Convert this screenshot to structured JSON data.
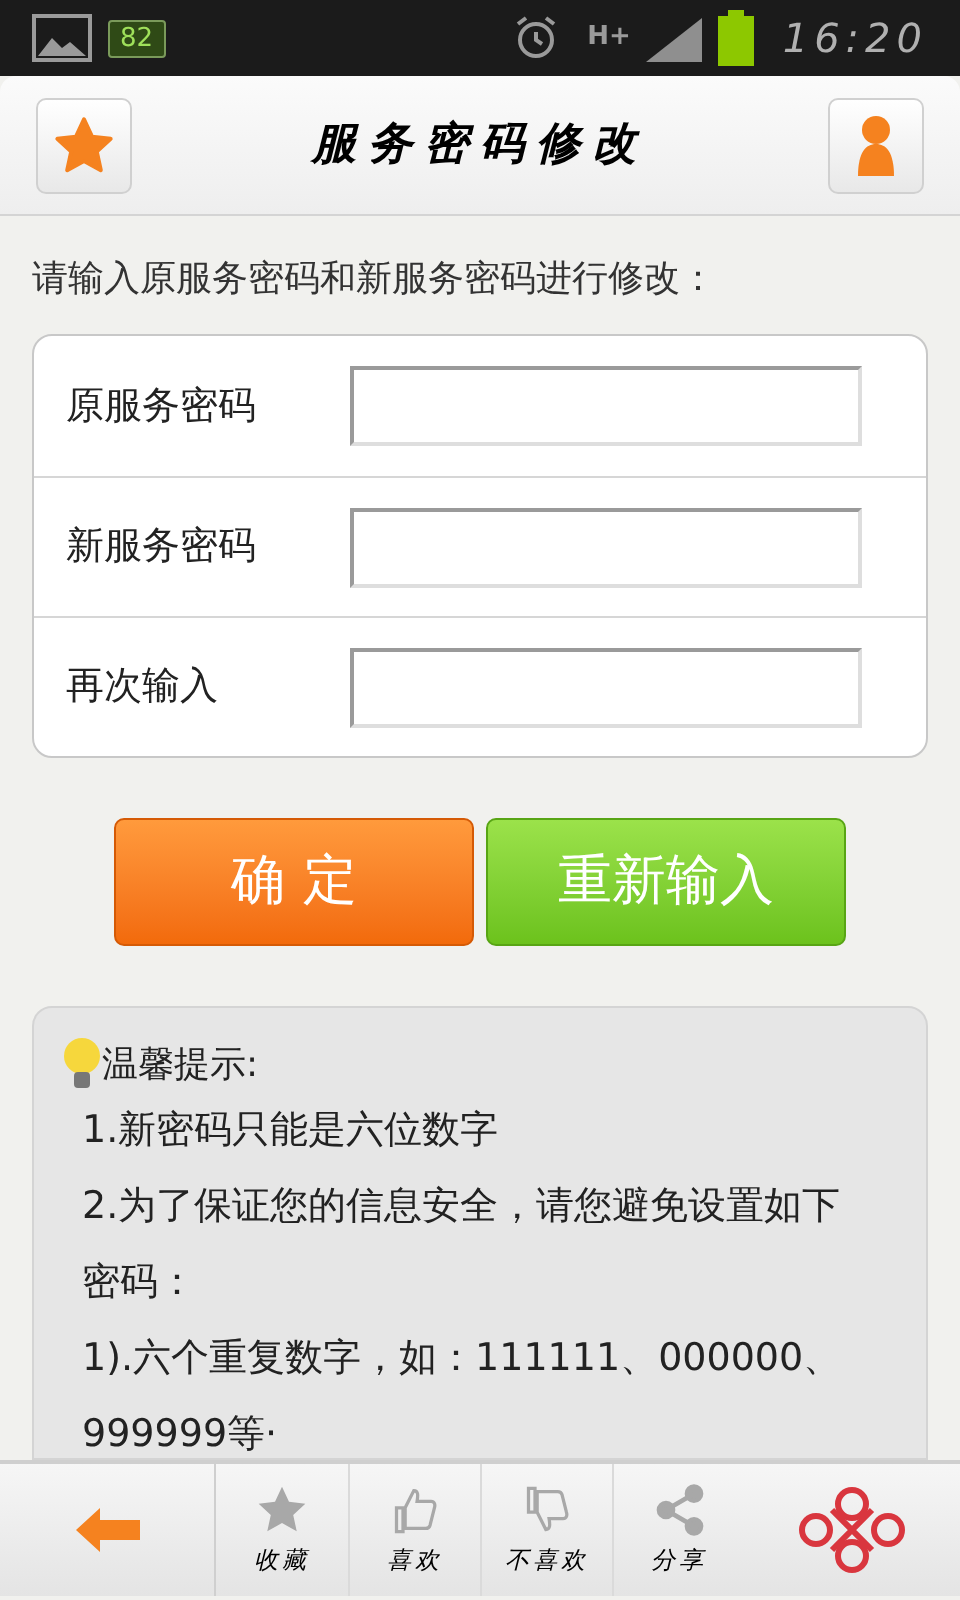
{
  "status_bar": {
    "battery_badge": "82",
    "network": "H+",
    "time": "16:20"
  },
  "header": {
    "title": "服务密码修改"
  },
  "instruction": "请输入原服务密码和新服务密码进行修改：",
  "fields": [
    {
      "label": "原服务密码"
    },
    {
      "label": "新服务密码"
    },
    {
      "label": "再次输入"
    }
  ],
  "buttons": [
    {
      "label": "确 定",
      "kind": "confirm"
    },
    {
      "label": "重新输入",
      "kind": "reset"
    }
  ],
  "tips": {
    "title": "温馨提示:",
    "items": [
      "1.新密码只能是六位数字",
      "2.为了保证您的信息安全，请您避免设置如下密码：",
      "1).六个重复数字，如：111111、000000、999999等·"
    ]
  },
  "bottom_bar": {
    "items": [
      {
        "kind": "star",
        "label": "收藏"
      },
      {
        "kind": "like",
        "label": "喜欢"
      },
      {
        "kind": "dislike",
        "label": "不喜欢"
      },
      {
        "kind": "share",
        "label": "分享"
      }
    ]
  }
}
